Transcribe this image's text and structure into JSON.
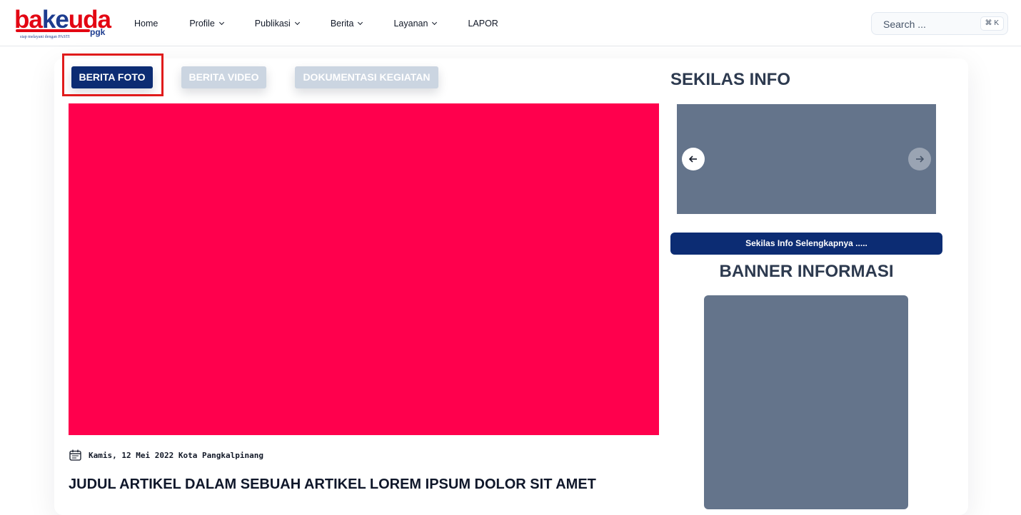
{
  "brand": {
    "logo_text_red1": "ba",
    "logo_text_blue": "ke",
    "logo_text_red2": "uda",
    "logo_suffix": "pgk",
    "tagline": "siap melayani dengan PASTI",
    "red": "#e30613",
    "blue": "#1d3c8f"
  },
  "nav": {
    "home": "Home",
    "profile": "Profile",
    "publikasi": "Publikasi",
    "berita": "Berita",
    "layanan": "Layanan",
    "lapor": "LAPOR"
  },
  "search": {
    "placeholder": "Search ...",
    "shortcut": "⌘ K"
  },
  "tabs": {
    "foto": "BERITA FOTO",
    "video": "BERITA VIDEO",
    "dokumentasi": "DOKUMENTASI KEGIATAN",
    "active": "foto"
  },
  "article": {
    "meta": "Kamis, 12 Mei 2022 Kota Pangkalpinang",
    "title": "JUDUL ARTIKEL DALAM SEBUAH ARTIKEL LOREM IPSUM DOLOR SIT AMET",
    "image_color": "#ff004d"
  },
  "sidebar": {
    "sekilas_title": "SEKILAS INFO",
    "more_label": "Sekilas Info Selengkapnya .....",
    "banner_title": "BANNER INFORMASI"
  },
  "colors": {
    "primary": "#0c2c73",
    "inactive_tab": "#cbd5e1",
    "placeholder": "#64748b",
    "highlight": "#e01b1b"
  }
}
